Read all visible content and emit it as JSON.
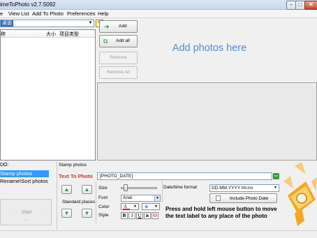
{
  "window": {
    "title": "imeToPhoto v2.7.5092"
  },
  "menu": [
    "e",
    "View",
    "List",
    "Add To Photo",
    "Preferences",
    "Help"
  ],
  "left_panel": {
    "path_value": "桌面",
    "columns": [
      "称",
      "大小",
      "项目类型"
    ]
  },
  "buttons": {
    "add": "Add",
    "add_all": "Add all",
    "remove": "Remove",
    "remove_all": "Remove All"
  },
  "drop_area": {
    "text": "Add photos here"
  },
  "todo": {
    "title": "DO:",
    "items": [
      "Stamp photos",
      "Rename\\Sort photos"
    ],
    "start": "Start"
  },
  "stamp": {
    "section_title": "Stamp photos",
    "text_label": "Text To Photo",
    "text_value": "[PHOTO_DATE]",
    "standard_places": "Standard places",
    "size_label": "Size",
    "font_label": "Font",
    "font_value": "Arial",
    "color_label": "Color",
    "style_label": "Style",
    "style_buttons": [
      "B",
      "I",
      "U",
      "S",
      "O"
    ],
    "datetime_label": "Date/time format",
    "datetime_value": "DD.MM.YYYY hh:nn",
    "include_date": "Include Photo Date",
    "hint": "Press and hold left mouse button to move the text label to any place of the photo"
  },
  "colors": {
    "selection": "#3399ff",
    "drop_text": "#4f8fd0",
    "stamp_label": "#c0392b",
    "arrow_green": "#2b9a3a"
  }
}
